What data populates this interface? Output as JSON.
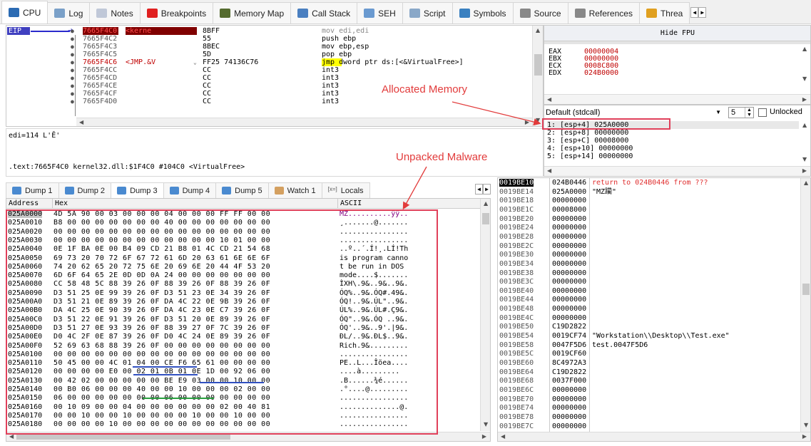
{
  "tabs": [
    {
      "label": "CPU",
      "icon": "cpu-icon",
      "color": "#2b6bb3",
      "active": true
    },
    {
      "label": "Log",
      "icon": "log-icon",
      "color": "#7aa0c8"
    },
    {
      "label": "Notes",
      "icon": "notes-icon",
      "color": "#c0c8d8"
    },
    {
      "label": "Breakpoints",
      "icon": "breakpoint-icon",
      "color": "#e02020"
    },
    {
      "label": "Memory Map",
      "icon": "memory-map-icon",
      "color": "#556b2f"
    },
    {
      "label": "Call Stack",
      "icon": "call-stack-icon",
      "color": "#4a7fc0"
    },
    {
      "label": "SEH",
      "icon": "seh-icon",
      "color": "#6a9ad0"
    },
    {
      "label": "Script",
      "icon": "script-icon",
      "color": "#8aa8c8"
    },
    {
      "label": "Symbols",
      "icon": "symbols-icon",
      "color": "#3a80c0"
    },
    {
      "label": "Source",
      "icon": "source-icon",
      "color": "#888"
    },
    {
      "label": "References",
      "icon": "references-icon",
      "color": "#888"
    },
    {
      "label": "Threa",
      "icon": "threads-icon",
      "color": "#e0a020"
    }
  ],
  "disasm": {
    "eip_label": "EIP",
    "rows": [
      {
        "addr": "7665F4C0",
        "label": "<kerne",
        "bytes": "8BFF",
        "instr": "mov edi,edi",
        "current": true
      },
      {
        "addr": "7665F4C2",
        "label": "",
        "bytes": "55",
        "instr": "push ebp"
      },
      {
        "addr": "7665F4C3",
        "label": "",
        "bytes": "8BEC",
        "instr": "mov ebp,esp"
      },
      {
        "addr": "7665F4C5",
        "label": "",
        "bytes": "5D",
        "instr": "pop ebp"
      },
      {
        "addr": "7665F4C6",
        "label": "<JMP.&V",
        "bytes": "FF25 74136C76",
        "instr": "jmp dword ptr ds:[<&VirtualFree>]",
        "jmp": true
      },
      {
        "addr": "7665F4CC",
        "label": "",
        "bytes": "CC",
        "instr": "int3"
      },
      {
        "addr": "7665F4CD",
        "label": "",
        "bytes": "CC",
        "instr": "int3"
      },
      {
        "addr": "7665F4CE",
        "label": "",
        "bytes": "CC",
        "instr": "int3"
      },
      {
        "addr": "7665F4CF",
        "label": "",
        "bytes": "CC",
        "instr": "int3"
      },
      {
        "addr": "7665F4D0",
        "label": "",
        "bytes": "CC",
        "instr": "int3"
      }
    ],
    "info_line1": "edi=114 L'Ē'",
    "info_line2": ".text:7665F4C0 kernel32.dll:$1F4C0 #104C0 <VirtualFree>"
  },
  "annotations": {
    "allocated": "Allocated Memory",
    "unpacked": "Unpacked Malware"
  },
  "registers": {
    "hide_fpu": "Hide FPU",
    "rows": [
      {
        "name": "EAX",
        "value": "00000004"
      },
      {
        "name": "EBX",
        "value": "00000000"
      },
      {
        "name": "ECX",
        "value": "0008C800"
      },
      {
        "name": "EDX",
        "value": "024B0000"
      }
    ]
  },
  "callconv": {
    "selected": "Default (stdcall)",
    "count": "5",
    "unlocked": "Unlocked",
    "args": [
      "1: [esp+4] 025A0000",
      "2: [esp+8] 00000000",
      "3: [esp+C] 00008000",
      "4: [esp+10] 00000000",
      "5: [esp+14] 00000000"
    ]
  },
  "dumptabs": [
    {
      "label": "Dump 1"
    },
    {
      "label": "Dump 2"
    },
    {
      "label": "Dump 3",
      "active": true
    },
    {
      "label": "Dump 4"
    },
    {
      "label": "Dump 5"
    },
    {
      "label": "Watch 1"
    },
    {
      "label": "Locals"
    }
  ],
  "dump": {
    "col_address": "Address",
    "col_hex": "Hex",
    "col_ascii": "ASCII",
    "rows": [
      {
        "addr": "025A0000",
        "hex": "4D 5A 90 00 03 00 00 00 04 00 00 00 FF FF 00 00",
        "ascii": "MZ..........ÿÿ.."
      },
      {
        "addr": "025A0010",
        "hex": "B8 00 00 00 00 00 00 00 40 00 00 00 00 00 00 00",
        "ascii": "¸.......@......."
      },
      {
        "addr": "025A0020",
        "hex": "00 00 00 00 00 00 00 00 00 00 00 00 00 00 00 00",
        "ascii": "................"
      },
      {
        "addr": "025A0030",
        "hex": "00 00 00 00 00 00 00 00 00 00 00 00 10 01 00 00",
        "ascii": "................"
      },
      {
        "addr": "025A0040",
        "hex": "0E 1F BA 0E 00 B4 09 CD 21 B8 01 4C CD 21 54 68",
        "ascii": "..º..´.Í!¸.LÍ!Th"
      },
      {
        "addr": "025A0050",
        "hex": "69 73 20 70 72 6F 67 72 61 6D 20 63 61 6E 6E 6F",
        "ascii": "is program canno"
      },
      {
        "addr": "025A0060",
        "hex": "74 20 62 65 20 72 75 6E 20 69 6E 20 44 4F 53 20",
        "ascii": "t be run in DOS "
      },
      {
        "addr": "025A0070",
        "hex": "6D 6F 64 65 2E 0D 0D 0A 24 00 00 00 00 00 00 00",
        "ascii": "mode....$......."
      },
      {
        "addr": "025A0080",
        "hex": "CC 58 48 5C 88 39 26 0F 88 39 26 0F 88 39 26 0F",
        "ascii": "ÌXH\\.9&..9&..9&."
      },
      {
        "addr": "025A0090",
        "hex": "D3 51 25 0E 99 39 26 0F D3 51 23 0E 34 39 26 0F",
        "ascii": "ÓQ%..9&.ÓQ#.49&."
      },
      {
        "addr": "025A00A0",
        "hex": "D3 51 21 0E 89 39 26 0F DA 4C 22 0E 9B 39 26 0F",
        "ascii": "ÓQ!..9&.ÚL\"..9&."
      },
      {
        "addr": "025A00B0",
        "hex": "DA 4C 25 0E 90 39 26 0F DA 4C 23 0E C7 39 26 0F",
        "ascii": "ÚL%..9&.ÚL#.Ç9&."
      },
      {
        "addr": "025A00C0",
        "hex": "D3 51 22 0E 91 39 26 0F D3 51 20 0E 89 39 26 0F",
        "ascii": "ÓQ\"..9&.ÓQ ..9&."
      },
      {
        "addr": "025A00D0",
        "hex": "D3 51 27 0E 93 39 26 0F 88 39 27 0F 7C 39 26 0F",
        "ascii": "ÓQ'..9&..9'.|9&."
      },
      {
        "addr": "025A00E0",
        "hex": "D0 4C 2F 0E 87 39 26 0F D0 4C 24 0E 89 39 26 0F",
        "ascii": "ÐL/..9&.ÐL$..9&."
      },
      {
        "addr": "025A00F0",
        "hex": "52 69 63 68 88 39 26 0F 00 00 00 00 00 00 00 00",
        "ascii": "Rich.9&........."
      },
      {
        "addr": "025A0100",
        "hex": "00 00 00 00 00 00 00 00 00 00 00 00 00 00 00 00",
        "ascii": "................"
      },
      {
        "addr": "025A0110",
        "hex": "50 45 00 00 4C 01 04 00 CE F6 65 61 00 00 00 00",
        "ascii": "PE..L...Îöea...."
      },
      {
        "addr": "025A0120",
        "hex": "00 00 00 00 E0 00 02 01 0B 01 0E 1D 00 92 06 00",
        "ascii": "....à........."
      },
      {
        "addr": "025A0130",
        "hex": "00 42 02 00 00 00 00 00 BE E9 03 00 00 10 00 00",
        "ascii": ".B......¾é......"
      },
      {
        "addr": "025A0140",
        "hex": "00 B0 06 00 00 00 40 00 00 10 00 00 00 02 00 00",
        "ascii": ".°....@........."
      },
      {
        "addr": "025A0150",
        "hex": "06 00 00 00 00 00 00 00 06 00 00 00 00 00 00 00",
        "ascii": "................"
      },
      {
        "addr": "025A0160",
        "hex": "00 10 09 00 00 04 00 00 00 00 00 00 02 00 40 81",
        "ascii": "..............@."
      },
      {
        "addr": "025A0170",
        "hex": "00 00 10 00 00 10 00 00 00 00 10 00 00 10 00 00",
        "ascii": "................"
      },
      {
        "addr": "025A0180",
        "hex": "00 00 00 00 10 00 00 00 00 00 00 00 00 00 00 00",
        "ascii": "................"
      }
    ]
  },
  "stack": {
    "rows": [
      {
        "addr": "0019BE10",
        "value": "024B0446",
        "comment": "return to 024B0446 from ???",
        "top": true
      },
      {
        "addr": "0019BE14",
        "value": "025A0000",
        "comment": "\"MZ躏\""
      },
      {
        "addr": "0019BE18",
        "value": "00000000",
        "comment": ""
      },
      {
        "addr": "0019BE1C",
        "value": "00008000",
        "comment": ""
      },
      {
        "addr": "0019BE20",
        "value": "00000000",
        "comment": ""
      },
      {
        "addr": "0019BE24",
        "value": "00000000",
        "comment": ""
      },
      {
        "addr": "0019BE28",
        "value": "00000000",
        "comment": ""
      },
      {
        "addr": "0019BE2C",
        "value": "00000000",
        "comment": ""
      },
      {
        "addr": "0019BE30",
        "value": "00000000",
        "comment": ""
      },
      {
        "addr": "0019BE34",
        "value": "00000000",
        "comment": ""
      },
      {
        "addr": "0019BE38",
        "value": "00000000",
        "comment": ""
      },
      {
        "addr": "0019BE3C",
        "value": "00000000",
        "comment": ""
      },
      {
        "addr": "0019BE40",
        "value": "00000000",
        "comment": ""
      },
      {
        "addr": "0019BE44",
        "value": "00000000",
        "comment": ""
      },
      {
        "addr": "0019BE48",
        "value": "00000000",
        "comment": ""
      },
      {
        "addr": "0019BE4C",
        "value": "00000000",
        "comment": ""
      },
      {
        "addr": "0019BE50",
        "value": "C19D2822",
        "comment": ""
      },
      {
        "addr": "0019BE54",
        "value": "0019CF74",
        "comment": "\"Workstation\\\\Desktop\\\\Test.exe\""
      },
      {
        "addr": "0019BE58",
        "value": "0047F5D6",
        "comment": "test.0047F5D6"
      },
      {
        "addr": "0019BE5C",
        "value": "0019CF60",
        "comment": ""
      },
      {
        "addr": "0019BE60",
        "value": "8C4972A3",
        "comment": ""
      },
      {
        "addr": "0019BE64",
        "value": "C19D2822",
        "comment": ""
      },
      {
        "addr": "0019BE68",
        "value": "0037F000",
        "comment": ""
      },
      {
        "addr": "0019BE6C",
        "value": "00000000",
        "comment": ""
      },
      {
        "addr": "0019BE70",
        "value": "00000000",
        "comment": ""
      },
      {
        "addr": "0019BE74",
        "value": "00000000",
        "comment": ""
      },
      {
        "addr": "0019BE78",
        "value": "00000000",
        "comment": ""
      },
      {
        "addr": "0019BE7C",
        "value": "00000000",
        "comment": ""
      }
    ]
  }
}
